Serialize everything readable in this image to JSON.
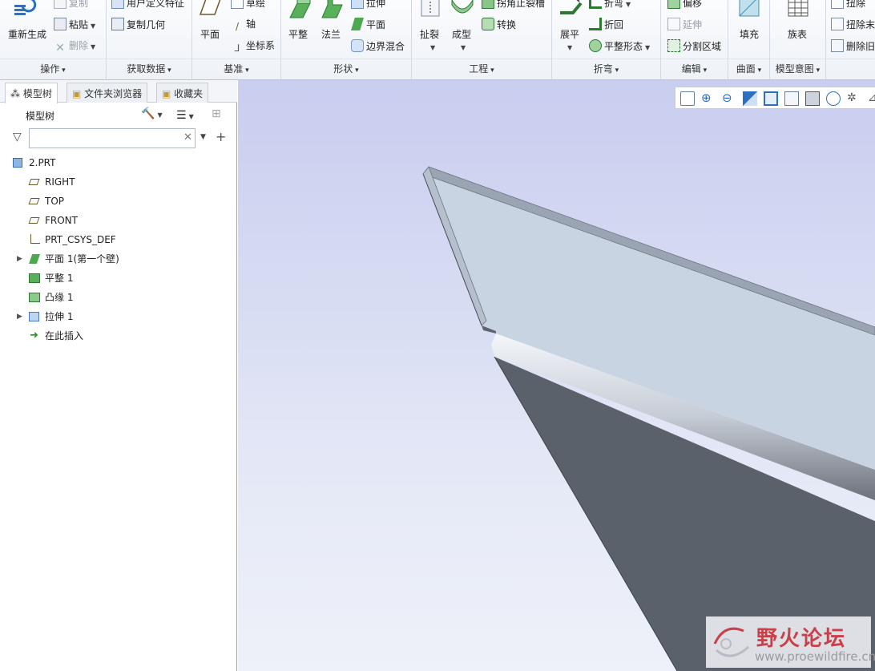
{
  "ribbon": {
    "groups": {
      "operations": "操作",
      "get_data": "获取数据",
      "datum": "基准",
      "shapes": "形状",
      "engineering": "工程",
      "bends": "折弯",
      "editing": "编辑",
      "surfaces": "曲面",
      "model_intent": "模型意图"
    },
    "operations": {
      "regenerate": "重新生成",
      "copy": "复制",
      "paste": "粘贴",
      "delete": "删除"
    },
    "get_data": {
      "udf": "用户定义特征",
      "copy_geom": "复制几何"
    },
    "datum": {
      "plane": "平面",
      "sketch": "草绘",
      "axis": "轴",
      "csys": "坐标系"
    },
    "shapes": {
      "flat": "平整",
      "flange": "法兰",
      "extrude": "拉伸",
      "planar": "平面",
      "boundary_blend": "边界混合"
    },
    "engineering": {
      "rip": "扯裂",
      "form": "成型",
      "corner_relief": "拐角止裂槽",
      "convert": "转换"
    },
    "bends": {
      "unbend": "展平",
      "bend": "折弯",
      "bend_back": "折回",
      "flatten_form": "平整形态"
    },
    "editing": {
      "offset": "偏移",
      "extend": "延伸",
      "split_area": "分割区域"
    },
    "surfaces": {
      "fill": "填充"
    },
    "model_intent": {
      "family_table": "族表"
    },
    "far_right": {
      "deform_area": "扭除",
      "deform_end": "扭除末",
      "delete_rel": "删除旧"
    }
  },
  "panel": {
    "tabs": [
      "模型树",
      "文件夹浏览器",
      "收藏夹"
    ],
    "tree_title": "模型树",
    "filter_placeholder": "",
    "nodes": [
      {
        "label": "2.PRT",
        "icon": "part-icon",
        "expand": false
      },
      {
        "label": "RIGHT",
        "icon": "datum-plane-icon",
        "expand": false
      },
      {
        "label": "TOP",
        "icon": "datum-plane-icon",
        "expand": false
      },
      {
        "label": "FRONT",
        "icon": "datum-plane-icon",
        "expand": false
      },
      {
        "label": "PRT_CSYS_DEF",
        "icon": "csys-icon",
        "expand": false
      },
      {
        "label": "平面 1(第一个壁)",
        "icon": "planar-wall-icon",
        "expand": true
      },
      {
        "label": "平整 1",
        "icon": "flat-wall-icon",
        "expand": false
      },
      {
        "label": "凸缘 1",
        "icon": "flange-icon",
        "expand": false
      },
      {
        "label": "拉伸 1",
        "icon": "extrude-icon",
        "expand": true
      },
      {
        "label": "在此插入",
        "icon": "insert-here-icon",
        "expand": false
      }
    ]
  },
  "watermark": {
    "title": "野火论坛",
    "url": "www.proewildfire.cn"
  },
  "colors": {
    "accent": "#2d6fbf",
    "sheet_top": "#c8d4e4",
    "sheet_side": "#5b616a",
    "insert_green": "#1a9a1a"
  }
}
